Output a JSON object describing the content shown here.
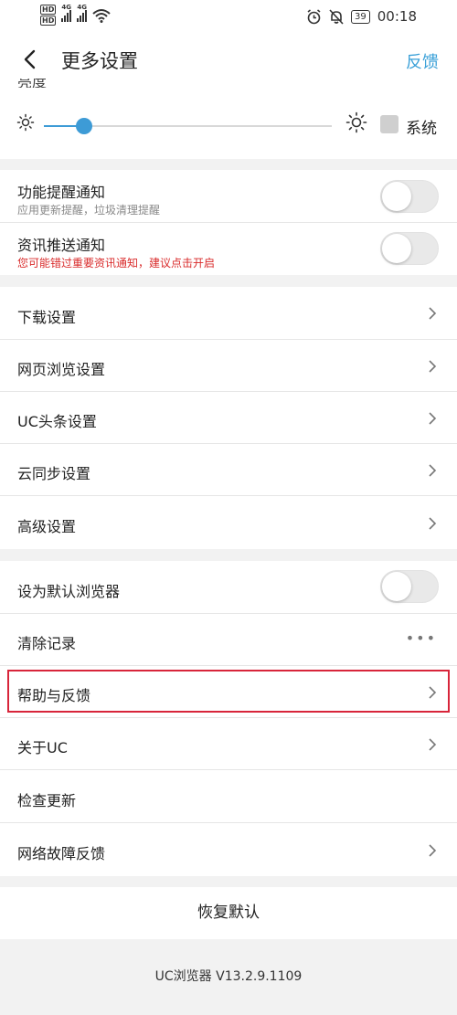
{
  "status_bar": {
    "hd_1": "HD",
    "hd_2": "HD",
    "net_1": "4G",
    "net_2": "4G",
    "battery": "39",
    "time": "00:18"
  },
  "nav": {
    "title": "更多设置",
    "feedback": "反馈"
  },
  "brightness": {
    "peek_label": "亮度",
    "system_label": "系统",
    "value_percent": 14
  },
  "notifications": [
    {
      "title": "功能提醒通知",
      "subtitle": "应用更新提醒，垃圾清理提醒"
    },
    {
      "title": "资讯推送通知",
      "subtitle": "您可能错过重要资讯通知，建议点击开启"
    }
  ],
  "settings": [
    "下载设置",
    "网页浏览设置",
    "UC头条设置",
    "云同步设置",
    "高级设置"
  ],
  "misc": {
    "default_browser": "设为默认浏览器",
    "clear_records": "清除记录",
    "clear_more": "•••",
    "help_feedback": "帮助与反馈",
    "about": "关于UC",
    "check_update": "检查更新",
    "network_feedback": "网络故障反馈"
  },
  "footer": {
    "restore": "恢复默认",
    "version": "UC浏览器 V13.2.9.1109"
  },
  "colors": {
    "accent": "#3aa0d8",
    "slider": "#3d9bd6",
    "highlight_border": "#d8253a",
    "warning_text": "#d92b2b"
  }
}
